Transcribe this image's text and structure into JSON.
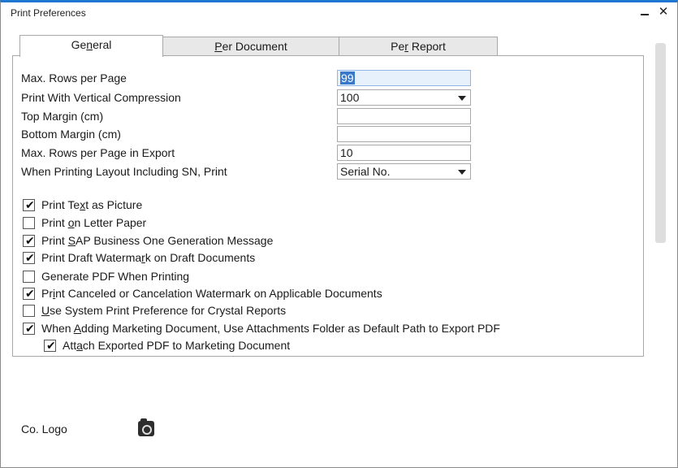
{
  "window": {
    "title": "Print Preferences",
    "minimize_symbol": "",
    "close_symbol": "✕"
  },
  "tabs": [
    {
      "pre": "Ge",
      "u": "n",
      "post": "eral"
    },
    {
      "pre": "",
      "u": "P",
      "post": "er Document"
    },
    {
      "pre": "Pe",
      "u": "r",
      "post": " Report"
    }
  ],
  "fields": {
    "max_rows": {
      "label": "Max. Rows per Page",
      "value": "99"
    },
    "vertical_compression": {
      "label": "Print With Vertical Compression",
      "value": "100"
    },
    "top_margin": {
      "label": "Top Margin (cm)",
      "value": ""
    },
    "bottom_margin": {
      "label": "Bottom Margin (cm)",
      "value": ""
    },
    "max_rows_export": {
      "label": "Max. Rows per Page in Export",
      "value": "10"
    },
    "sn_print": {
      "label": "When Printing Layout Including SN, Print",
      "value": "Serial No."
    }
  },
  "checkboxes": [
    {
      "pre": "Print Te",
      "u": "x",
      "post": "t as Picture",
      "checked": true
    },
    {
      "pre": "Print ",
      "u": "o",
      "post": "n Letter Paper",
      "checked": false
    },
    {
      "pre": "Print ",
      "u": "S",
      "post": "AP Business One Generation Message",
      "checked": true
    },
    {
      "pre": "Print Draft Waterma",
      "u": "r",
      "post": "k on Draft Documents",
      "checked": true
    },
    {
      "pre": "Generate PDF When Printing",
      "u": "",
      "post": "",
      "checked": false
    },
    {
      "pre": "Pr",
      "u": "i",
      "post": "nt Canceled or Cancelation Watermark on Applicable Documents",
      "checked": true
    },
    {
      "pre": "",
      "u": "U",
      "post": "se System Print Preference for Crystal Reports",
      "checked": false
    },
    {
      "pre": "When ",
      "u": "A",
      "post": "dding Marketing Document, Use Attachments Folder as Default Path to Export PDF",
      "checked": true
    },
    {
      "pre": "Att",
      "u": "a",
      "post": "ch Exported PDF to Marketing Document",
      "checked": true
    }
  ],
  "check_glyph": "✔",
  "co_logo": {
    "label": "Co. Logo",
    "icon": "camera-icon"
  }
}
